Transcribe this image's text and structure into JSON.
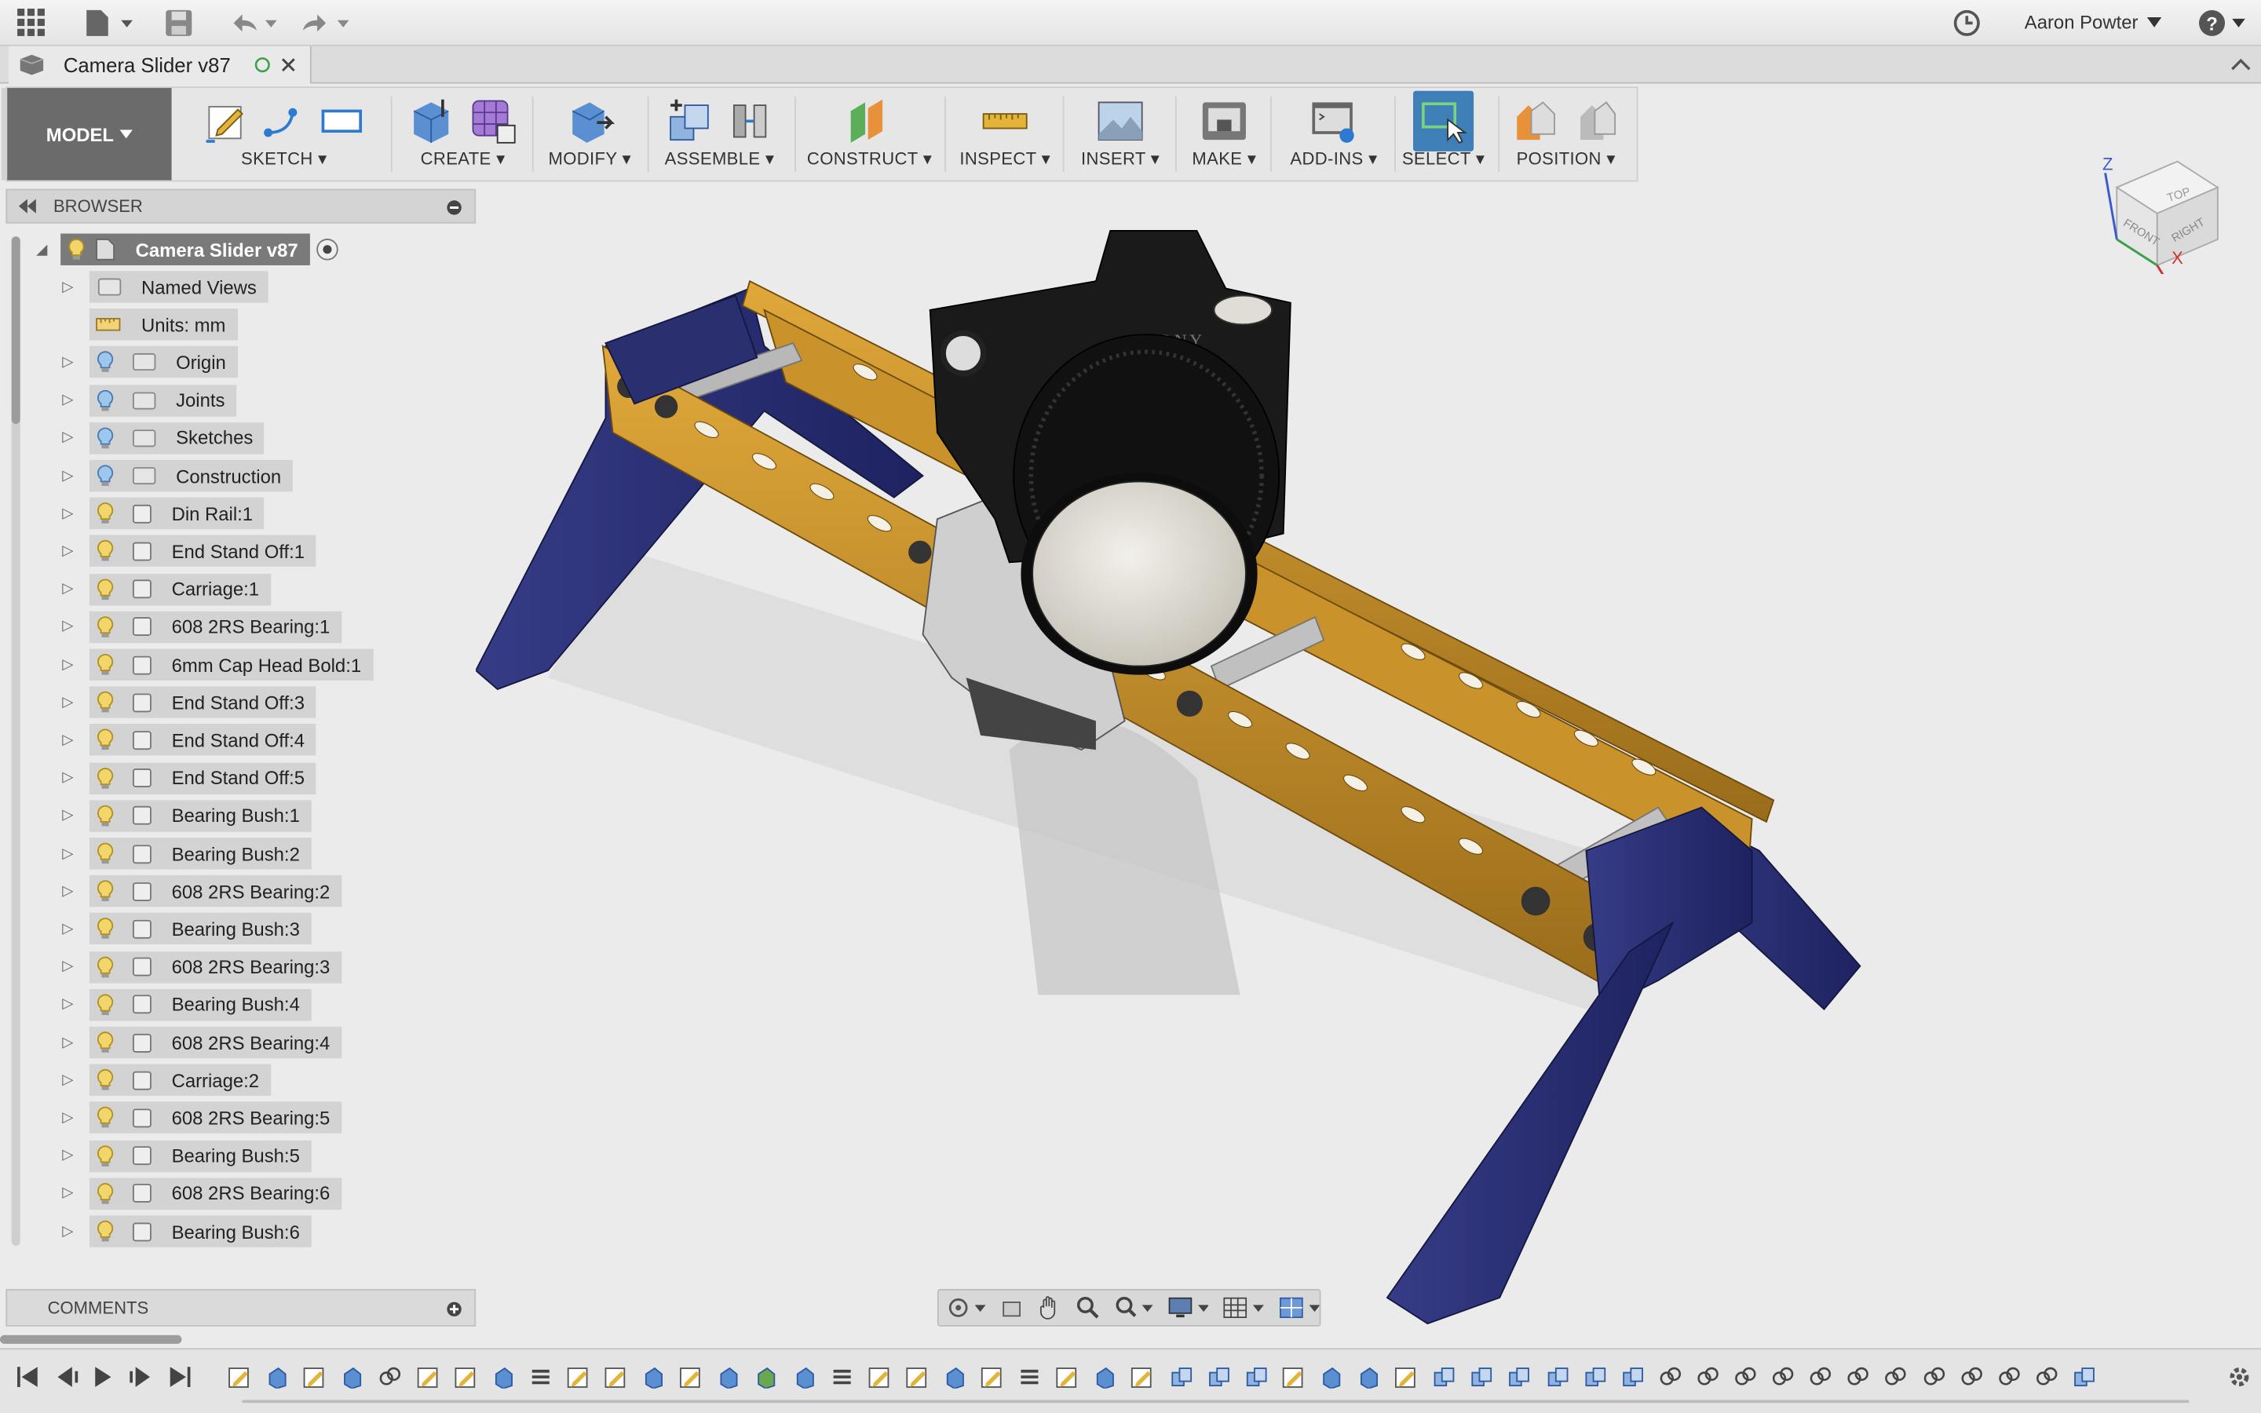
{
  "app": {
    "user": "Aaron Powter"
  },
  "document": {
    "title": "Camera Slider v87"
  },
  "toolbar": {
    "workspace": "MODEL",
    "groups": [
      "SKETCH",
      "CREATE",
      "MODIFY",
      "ASSEMBLE",
      "CONSTRUCT",
      "INSPECT",
      "INSERT",
      "MAKE",
      "ADD-INS",
      "SELECT",
      "POSITION"
    ]
  },
  "browser": {
    "title": "BROWSER",
    "root": "Camera Slider v87",
    "items": [
      {
        "label": "Named Views",
        "type": "folder",
        "bulb": false
      },
      {
        "label": "Units: mm",
        "type": "units",
        "bulb": false
      },
      {
        "label": "Origin",
        "type": "folder",
        "bulb": true
      },
      {
        "label": "Joints",
        "type": "folder",
        "bulb": true
      },
      {
        "label": "Sketches",
        "type": "folder",
        "bulb": true
      },
      {
        "label": "Construction",
        "type": "folder",
        "bulb": true
      },
      {
        "label": "Din Rail:1",
        "type": "component",
        "bulb": true
      },
      {
        "label": "End Stand Off:1",
        "type": "component",
        "bulb": true
      },
      {
        "label": "Carriage:1",
        "type": "component",
        "bulb": true
      },
      {
        "label": "608 2RS Bearing:1",
        "type": "component",
        "bulb": true
      },
      {
        "label": "6mm Cap Head Bold:1",
        "type": "component",
        "bulb": true
      },
      {
        "label": "End Stand Off:3",
        "type": "component",
        "bulb": true
      },
      {
        "label": "End Stand Off:4",
        "type": "component",
        "bulb": true
      },
      {
        "label": "End Stand Off:5",
        "type": "component",
        "bulb": true
      },
      {
        "label": "Bearing Bush:1",
        "type": "component",
        "bulb": true
      },
      {
        "label": "Bearing Bush:2",
        "type": "component",
        "bulb": true
      },
      {
        "label": "608 2RS Bearing:2",
        "type": "component",
        "bulb": true
      },
      {
        "label": "Bearing Bush:3",
        "type": "component",
        "bulb": true
      },
      {
        "label": "608 2RS Bearing:3",
        "type": "component",
        "bulb": true
      },
      {
        "label": "Bearing Bush:4",
        "type": "component",
        "bulb": true
      },
      {
        "label": "608 2RS Bearing:4",
        "type": "component",
        "bulb": true
      },
      {
        "label": "Carriage:2",
        "type": "component",
        "bulb": true
      },
      {
        "label": "608 2RS Bearing:5",
        "type": "component",
        "bulb": true
      },
      {
        "label": "Bearing Bush:5",
        "type": "component",
        "bulb": true
      },
      {
        "label": "608 2RS Bearing:6",
        "type": "component",
        "bulb": true
      },
      {
        "label": "Bearing Bush:6",
        "type": "component",
        "bulb": true
      }
    ]
  },
  "comments": {
    "title": "COMMENTS"
  },
  "viewcube": {
    "top": "TOP",
    "front": "FRONT",
    "right": "RIGHT",
    "z": "Z",
    "x": "X"
  },
  "camera_brand": "SONY",
  "colors": {
    "rail": "#c9922a",
    "legs": "#2a2f70",
    "model_btn": "#6b6b6b",
    "select_active": "#3e7fb8"
  }
}
